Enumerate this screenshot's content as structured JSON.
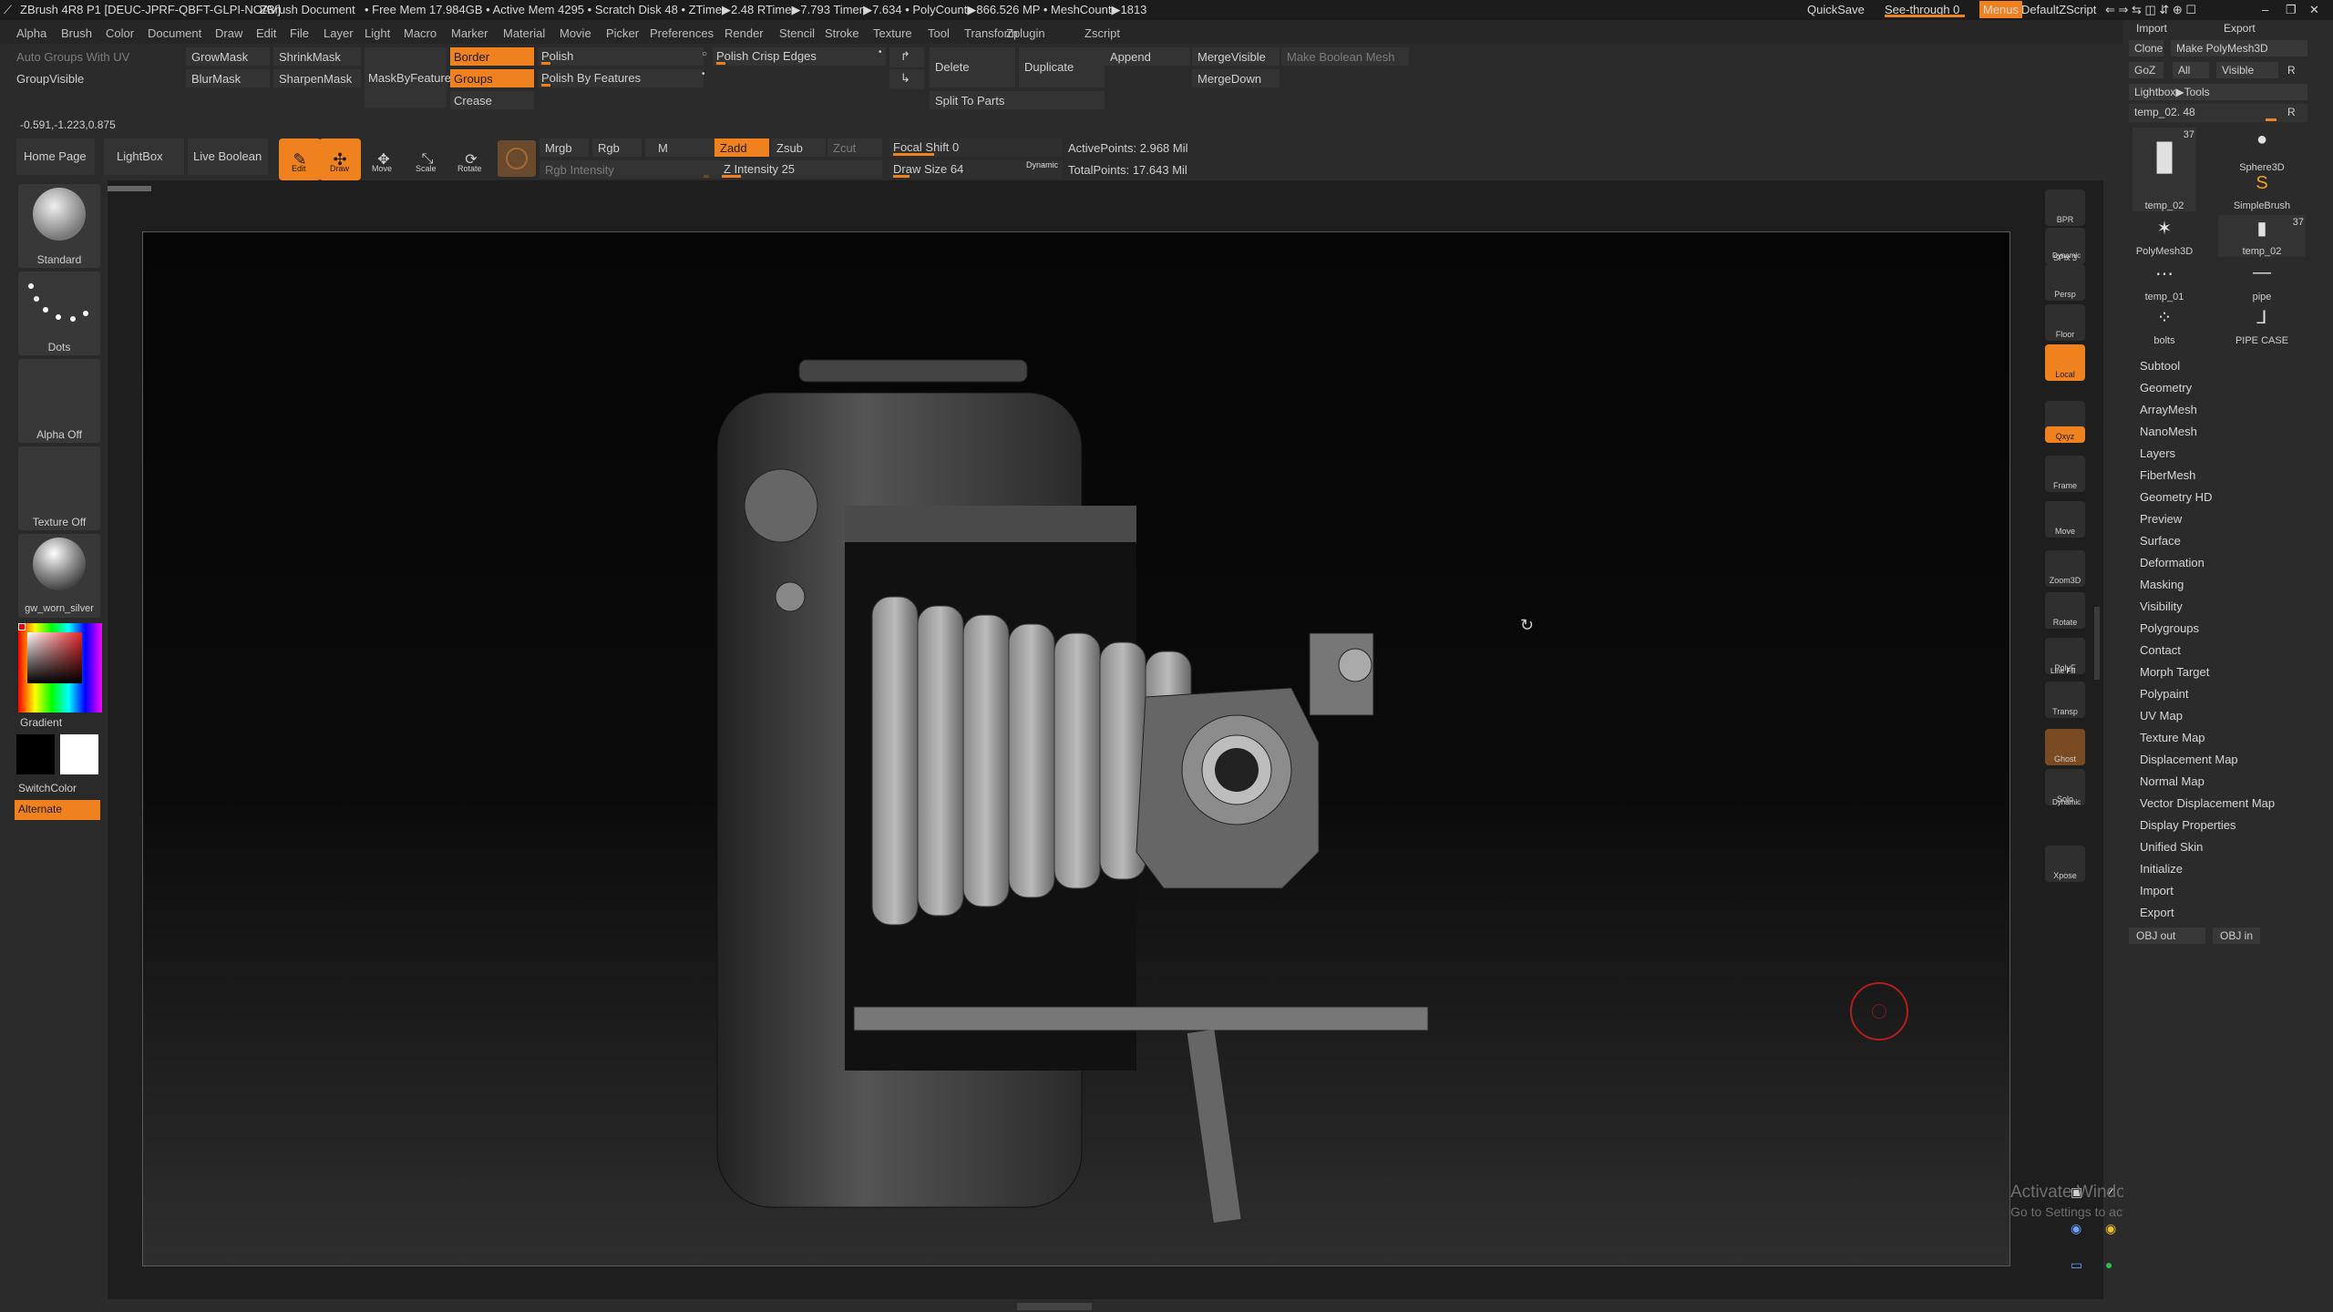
{
  "title_bar": {
    "app": "ZBrush 4R8 P1 [DEUC-JPRF-QBFT-GLPI-NOAV]",
    "document": "ZBrush Document",
    "stats": "• Free Mem 17.984GB • Active Mem 4295 • Scratch Disk 48 • ZTime▶2.48 RTime▶7.793 Timer▶7.634 • PolyCount▶866.526 MP • MeshCount▶1813",
    "quicksave": "QuickSave",
    "see_through": "See-through  0",
    "menus": "Menus",
    "script": "DefaultZScript"
  },
  "menu_bar": [
    "Alpha",
    "Brush",
    "Color",
    "Document",
    "Draw",
    "Edit",
    "File",
    "Layer",
    "Light",
    "Macro",
    "Marker",
    "Material",
    "Movie",
    "Picker",
    "Preferences",
    "Render",
    "Stencil",
    "Stroke",
    "Texture",
    "Tool",
    "Transform",
    "Zplugin",
    "Zscript"
  ],
  "top_palette": {
    "auto_groups": "Auto Groups With UV",
    "group_visible": "GroupVisible",
    "grow_mask": "GrowMask",
    "shrink_mask": "ShrinkMask",
    "blur_mask": "BlurMask",
    "sharpen_mask": "SharpenMask",
    "mask_by_feature": "MaskByFeature",
    "border": "Border",
    "groups": "Groups",
    "crease": "Crease",
    "polish": "Polish",
    "polish_by_features": "Polish By Features",
    "polish_crisp_edges": "Polish Crisp Edges",
    "delete": "Delete",
    "duplicate": "Duplicate",
    "split_to_parts": "Split To Parts",
    "append": "Append",
    "merge_visible": "MergeVisible",
    "merge_down": "MergeDown",
    "make_boolean_mesh": "Make Boolean Mesh"
  },
  "coords": "-0.591,-1.223,0.875",
  "toolbar": {
    "home_page": "Home Page",
    "lightbox": "LightBox",
    "live_boolean": "Live Boolean",
    "edit": "Edit",
    "draw": "Draw",
    "move": "Move",
    "scale": "Scale",
    "rotate": "Rotate",
    "mrgb": "Mrgb",
    "rgb": "Rgb",
    "m": "M",
    "rgb_intensity": "Rgb Intensity",
    "zadd": "Zadd",
    "zsub": "Zsub",
    "zcut": "Zcut",
    "z_intensity": "Z Intensity 25",
    "focal_shift": "Focal Shift 0",
    "draw_size": "Draw Size 64",
    "dynamic": "Dynamic",
    "active_points": "ActivePoints: 2.968 Mil",
    "total_points": "TotalPoints: 17.643 Mil",
    "z_intensity_level": 0.25,
    "focal_shift_level": 0.5,
    "draw_size_level": 0.2
  },
  "left_shelf": {
    "brush": "Standard",
    "stroke": "Dots",
    "alpha": "Alpha Off",
    "texture": "Texture Off",
    "material": "gw_worn_silver",
    "gradient": "Gradient",
    "switch_color": "SwitchColor",
    "alternate": "Alternate"
  },
  "right_shelf": [
    "BPR",
    "SPix 3",
    "Persp",
    "Floor",
    "Local",
    "L.Sym",
    "Qxyz",
    "Frame",
    "Move",
    "Zoom3D",
    "Rotate",
    "PolyF",
    "Transp",
    "Ghost",
    "Solo",
    "Xpose"
  ],
  "right_shelf_dynamic": "Dynamic",
  "right_shelf_linefill": "Line Fill",
  "tool_panel": {
    "import": "Import",
    "export": "Export",
    "clone": "Clone",
    "make_polymesh": "Make PolyMesh3D",
    "goz": "GoZ",
    "all": "All",
    "visible": "Visible",
    "r": "R",
    "lightbox_tools": "Lightbox▶Tools",
    "current_tool": "temp_02. 48",
    "tools": [
      {
        "name": "temp_02",
        "count": "37"
      },
      {
        "name": "Sphere3D",
        "count": ""
      },
      {
        "name": "SimpleBrush",
        "count": ""
      },
      {
        "name": "PolyMesh3D",
        "count": ""
      },
      {
        "name": "temp_02",
        "count": "37"
      },
      {
        "name": "temp_01",
        "count": ""
      },
      {
        "name": "pipe",
        "count": ""
      },
      {
        "name": "bolts",
        "count": ""
      },
      {
        "name": "PIPE CASE",
        "count": ""
      }
    ],
    "subpalettes": [
      "Subtool",
      "Geometry",
      "ArrayMesh",
      "NanoMesh",
      "Layers",
      "FiberMesh",
      "Geometry HD",
      "Preview",
      "Surface",
      "Deformation",
      "Masking",
      "Visibility",
      "Polygroups",
      "Contact",
      "Morph Target",
      "Polypaint",
      "UV Map",
      "Texture Map",
      "Displacement Map",
      "Normal Map",
      "Vector Displacement Map",
      "Display Properties",
      "Unified Skin",
      "Initialize",
      "Import",
      "Export"
    ],
    "obj_out": "OBJ out",
    "obj_in": "OBJ in"
  },
  "watermark": {
    "line1": "Activate Windows",
    "line2": "Go to Settings to activate Windows."
  },
  "colors": {
    "accent": "#f0811f",
    "canvas": "#1a1a1a"
  }
}
